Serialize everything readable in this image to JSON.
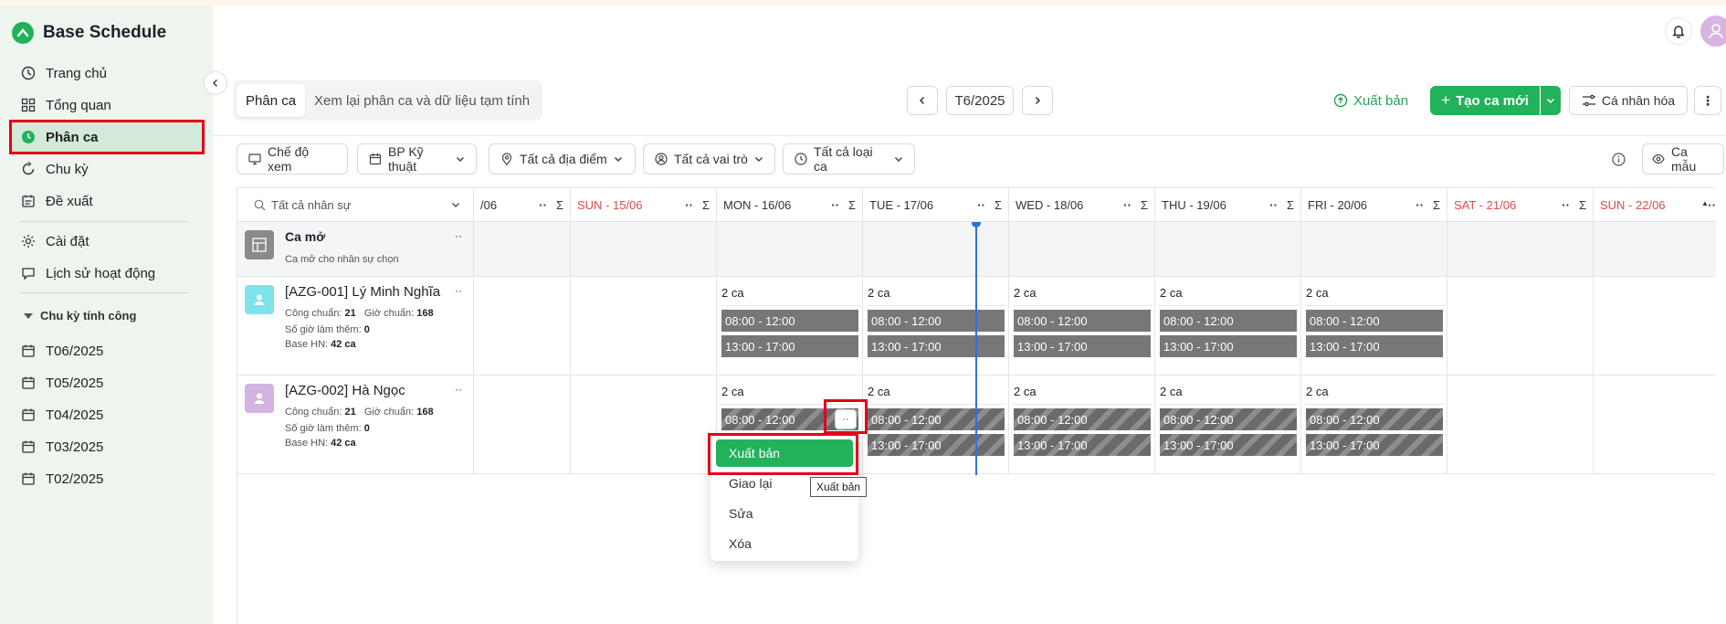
{
  "app": {
    "name": "Base Schedule"
  },
  "nav": {
    "items": [
      {
        "label": "Trang chủ",
        "icon": "clock-icon"
      },
      {
        "label": "Tổng quan",
        "icon": "grid-icon"
      },
      {
        "label": "Phân ca",
        "icon": "shift-icon",
        "active": true
      },
      {
        "label": "Chu kỳ",
        "icon": "cycle-icon"
      },
      {
        "label": "Đề xuất",
        "icon": "proposal-icon"
      },
      {
        "label": "Cài đặt",
        "icon": "gear-icon"
      },
      {
        "label": "Lịch sử hoạt động",
        "icon": "history-icon"
      }
    ],
    "cycle_group_title": "Chu kỳ tính công",
    "cycles": [
      "T06/2025",
      "T05/2025",
      "T04/2025",
      "T03/2025",
      "T02/2025"
    ]
  },
  "toolbar": {
    "tabs": [
      "Phân ca",
      "Xem lại phân ca và dữ liệu tạm tính"
    ],
    "period": "T6/2025",
    "publish_label": "Xuất bản",
    "create_label": "Tạo ca mới",
    "personalize_label": "Cá nhân hóa"
  },
  "filters": {
    "view_mode": "Chế độ xem",
    "department": "BP Kỹ thuật",
    "location": "Tất cả địa điểm",
    "role": "Tất cả vai trò",
    "shift_type": "Tất cả loại ca",
    "template": "Ca mẫu"
  },
  "grid": {
    "search_placeholder": "Tất cả nhân sự",
    "days": [
      {
        "label": "/06",
        "weekend": false
      },
      {
        "label": "SUN - 15/06",
        "weekend": true
      },
      {
        "label": "MON - 16/06",
        "weekend": false
      },
      {
        "label": "TUE - 17/06",
        "weekend": false
      },
      {
        "label": "WED - 18/06",
        "weekend": false
      },
      {
        "label": "THU - 19/06",
        "weekend": false
      },
      {
        "label": "FRI - 20/06",
        "weekend": false
      },
      {
        "label": "SAT - 21/06",
        "weekend": true
      },
      {
        "label": "SUN - 22/06",
        "weekend": true
      }
    ],
    "open_shift": {
      "title": "Ca mở",
      "subtitle": "Ca mở cho nhân sự chọn"
    },
    "employees": [
      {
        "name": "[AZG-001] Lý Minh Nghĩa",
        "standard_label": "Công chuẩn:",
        "standard_value": "21",
        "hours_label": "Giờ chuẩn:",
        "hours_value": "168",
        "overtime_label": "Số giờ làm thêm:",
        "overtime_value": "0",
        "base_label": "Base HN:",
        "base_value": "42 ca",
        "avatar_color": "#7fe3ea",
        "count_label": "2 ca",
        "shifts": [
          "08:00 - 12:00",
          "13:00 - 17:00"
        ],
        "draft": false
      },
      {
        "name": "[AZG-002] Hà Ngọc",
        "standard_label": "Công chuẩn:",
        "standard_value": "21",
        "hours_label": "Giờ chuẩn:",
        "hours_value": "168",
        "overtime_label": "Số giờ làm thêm:",
        "overtime_value": "0",
        "base_label": "Base HN:",
        "base_value": "42 ca",
        "avatar_color": "#d3b3e0",
        "count_label": "2 ca",
        "shifts": [
          "08:00 - 12:00",
          "13:00 - 17:00"
        ],
        "draft": true
      }
    ]
  },
  "context_menu": {
    "items": [
      "Xuất bản",
      "Giao lại",
      "Sửa",
      "Xóa"
    ],
    "tooltip": "Xuất bản",
    "more_label": "··"
  },
  "colors": {
    "brand": "#22b25a",
    "weekend": "#e04b4b",
    "today_line": "#2f6fe0",
    "highlight": "#e3001b"
  }
}
